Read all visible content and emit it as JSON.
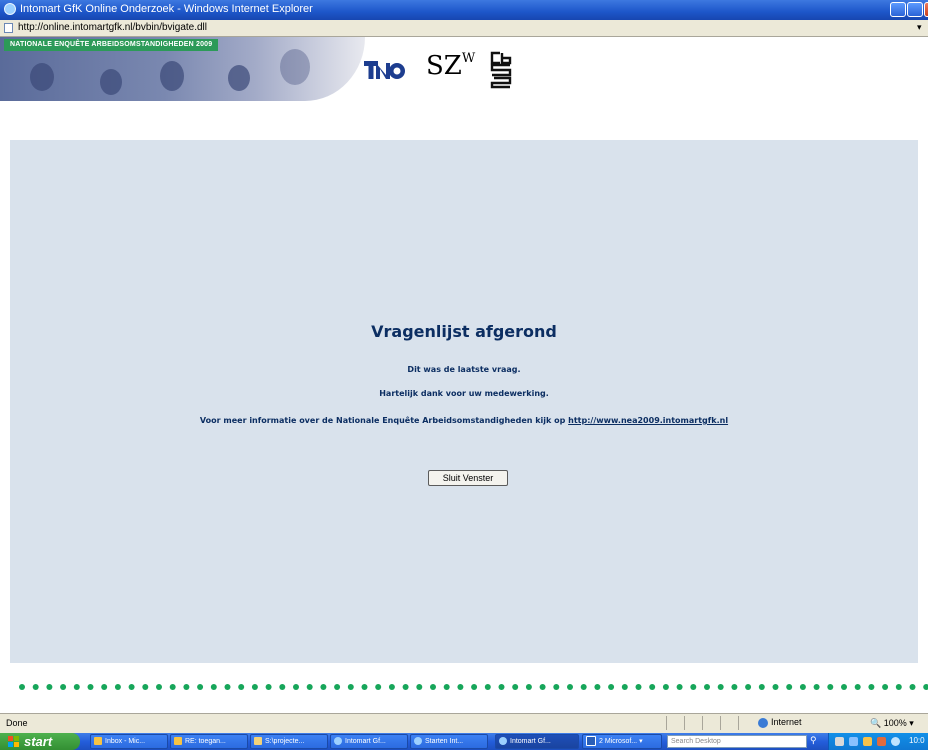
{
  "window": {
    "title": "Intomart GfK Online Onderzoek - Windows Internet Explorer",
    "address": "http://online.intomartgfk.nl/bvbin/bvigate.dll"
  },
  "banner": {
    "tag": "NATIONALE ENQUÊTE ARBEIDSOMSTANDIGHEDEN 2009",
    "logo_szw": "SZ",
    "logo_szw_sup": "W"
  },
  "page": {
    "heading": "Vragenlijst afgerond",
    "message1": "Dit was de laatste vraag.",
    "message2": "Hartelijk dank voor uw medewerking.",
    "message3_prefix": "Voor meer informatie over de Nationale Enquête Arbeidsomstandigheden kijk op",
    "link_text": "http://www.nea2009.intomartgfk.nl",
    "close_button": "Sluit Venster"
  },
  "statusbar": {
    "status": "Done",
    "zone": "Internet",
    "zoom": "100%"
  },
  "taskbar": {
    "start_label": "start",
    "tasks": [
      {
        "label": "Inbox - Mic..."
      },
      {
        "label": "RE: toegan..."
      },
      {
        "label": "S:\\projecte..."
      },
      {
        "label": "Intomart Gf..."
      },
      {
        "label": "Starten Int..."
      },
      {
        "label": "Intomart Gf..."
      },
      {
        "label": "2 Microsof..."
      }
    ],
    "search_placeholder": "Search Desktop",
    "clock": "10:0"
  },
  "colors": {
    "heading": "#0c2e62",
    "main_bg": "#d9e2ec",
    "dots": "#17a65a",
    "banner_tag": "#2c9a58"
  }
}
